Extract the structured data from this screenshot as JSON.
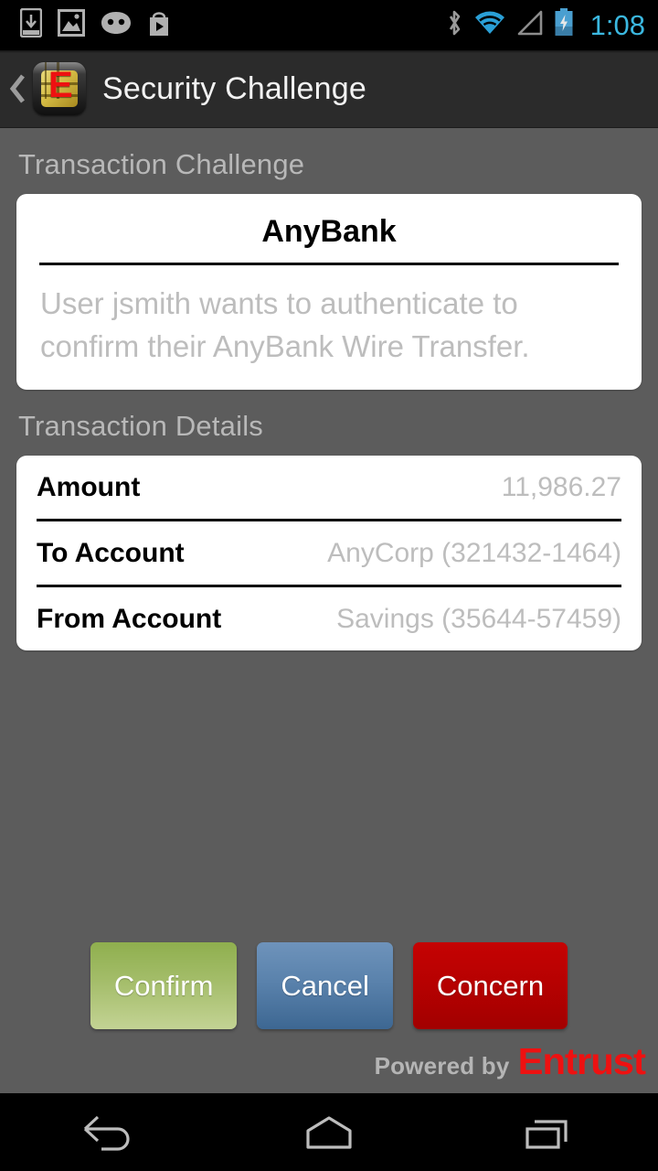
{
  "statusbar": {
    "time": "1:08",
    "left_icons": [
      {
        "name": "download-icon",
        "label": "download"
      },
      {
        "name": "screenshot-image-icon",
        "label": "screenshot"
      },
      {
        "name": "cyanogenmod-icon",
        "label": "cyanogenmod"
      },
      {
        "name": "play-store-icon",
        "label": "play-store"
      }
    ],
    "right_icons": [
      {
        "name": "bluetooth-icon",
        "label": "bluetooth"
      },
      {
        "name": "wifi-icon",
        "label": "wifi"
      },
      {
        "name": "cellular-signal-icon",
        "label": "signal"
      },
      {
        "name": "battery-charging-icon",
        "label": "battery-charging"
      }
    ]
  },
  "actionbar": {
    "title": "Security Challenge",
    "back_icon": "back-chevron-icon",
    "app_icon": "entrust-identityguard-icon",
    "app_icon_letter": "E"
  },
  "main": {
    "challenge_section_header": "Transaction Challenge",
    "challenge_card": {
      "bank_name": "AnyBank",
      "message": "User jsmith wants to authenticate to confirm their AnyBank Wire Transfer."
    },
    "details_section_header": "Transaction Details",
    "details_rows": [
      {
        "label": "Amount",
        "value": "11,986.27"
      },
      {
        "label": "To Account",
        "value": "AnyCorp (321432-1464)"
      },
      {
        "label": "From Account",
        "value": "Savings (35644-57459)"
      }
    ]
  },
  "buttons": {
    "confirm": "Confirm",
    "cancel": "Cancel",
    "concern": "Concern"
  },
  "footer": {
    "powered_by": "Powered by",
    "brand": "Entrust"
  },
  "navbar": {
    "back": "back-nav-icon",
    "home": "home-nav-icon",
    "recents": "recents-nav-icon"
  },
  "colors": {
    "background": "#5c5c5c",
    "actionbar": "#2b2b2b",
    "card": "#ffffff",
    "muted_text": "#bdbdbd",
    "section_header_text": "#b8b8b8",
    "confirm_green": "#8faf4e",
    "cancel_blue": "#5a82ac",
    "concern_red": "#b70101",
    "brand_red": "#ee1111",
    "clock_blue": "#3bb8e0"
  }
}
